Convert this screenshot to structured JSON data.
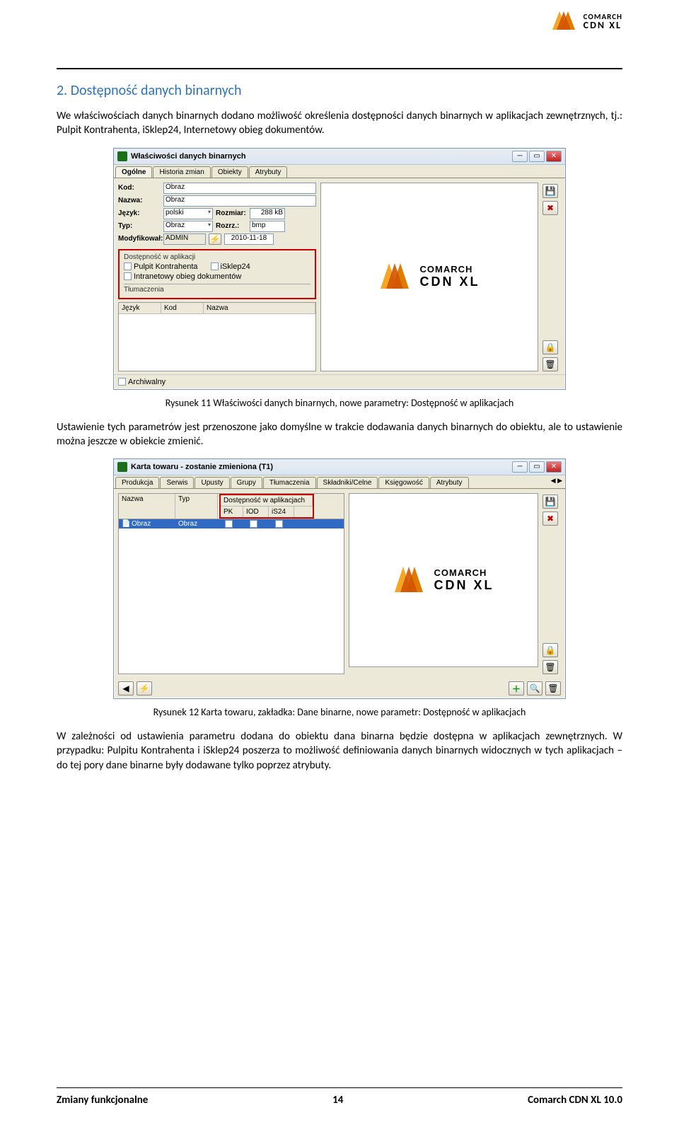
{
  "brand": {
    "name": "COMARCH",
    "product": "CDN XL"
  },
  "section_title": "2.  Dostępność danych binarnych",
  "para1": "We właściwościach danych binarnych dodano możliwość określenia dostępności danych binarnych w aplikacjach zewnętrznych, tj.: Pulpit Kontrahenta, iSklep24, Internetowy obieg dokumentów.",
  "win1": {
    "title": "Właściwości danych binarnych",
    "tabs": [
      "Ogólne",
      "Historia zmian",
      "Obiekty",
      "Atrybuty"
    ],
    "fields": {
      "kod_label": "Kod:",
      "kod_value": "Obraz",
      "nazwa_label": "Nazwa:",
      "nazwa_value": "Obraz",
      "jezyk_label": "Język:",
      "jezyk_value": "polski",
      "rozmiar_label": "Rozmiar:",
      "rozmiar_value": "288 kB",
      "typ_label": "Typ:",
      "typ_value": "Obraz",
      "rozrz_label": "Rozrz.:",
      "rozrz_value": "bmp",
      "mod_label": "Modyfikował:",
      "mod_user": "ADMIN",
      "mod_date": "2010-11-18"
    },
    "group_title": "Dostępność w aplikacji",
    "checks": {
      "pk": "Pulpit Kontrahenta",
      "isk": "iSklep24",
      "iod": "Intranetowy obieg dokumentów"
    },
    "group2_title": "Tłumaczenia",
    "grid_cols": [
      "Język",
      "Kod",
      "Nazwa"
    ],
    "archiwalny": "Archiwalny",
    "side_save_glyph": "💾",
    "side_close_glyph": "✖",
    "side_lock_glyph": "🔒",
    "side_trash_glyph": "🗑"
  },
  "caption1": "Rysunek 11 Właściwości danych binarnych, nowe parametry: Dostępność w aplikacjach",
  "para2": "Ustawienie tych parametrów jest przenoszone jako domyślne w trakcie dodawania danych binarnych do obiektu, ale to ustawienie można jeszcze w obiekcie zmienić.",
  "win2": {
    "title": "Karta towaru - zostanie zmieniona (T1)",
    "tabs": [
      "Produkcja",
      "Serwis",
      "Upusty",
      "Grupy",
      "Tłumaczenia",
      "Składniki/Celne",
      "Księgowość",
      "Atrybuty"
    ],
    "cols": {
      "nazwa": "Nazwa",
      "typ": "Typ",
      "dost": "Dostępność w aplikacjach",
      "pk": "PK",
      "iod": "IOD",
      "is24": "iS24"
    },
    "row": {
      "nazwa": "Obraz",
      "typ": "Obraz",
      "pk_checked": "☑"
    },
    "bottom_btns": {
      "left1": "◀",
      "left2": "⚡",
      "add": "＋",
      "search": "🔍",
      "del": "🗑",
      "lock": "🔒",
      "trash2": "🗑"
    }
  },
  "caption2": "Rysunek 12 Karta towaru, zakładka: Dane binarne, nowe parametr: Dostępność w aplikacjach",
  "para3": "W zależności od ustawienia parametru dodana do obiektu dana binarna będzie dostępna w aplikacjach zewnętrznych. W przypadku: Pulpitu Kontrahenta i iSklep24 poszerza to możliwość definiowania danych binarnych widocznych w tych aplikacjach – do tej pory dane binarne były dodawane tylko poprzez atrybuty.",
  "footer": {
    "left": "Zmiany funkcjonalne",
    "center": "14",
    "right": "Comarch CDN XL 10.0"
  }
}
